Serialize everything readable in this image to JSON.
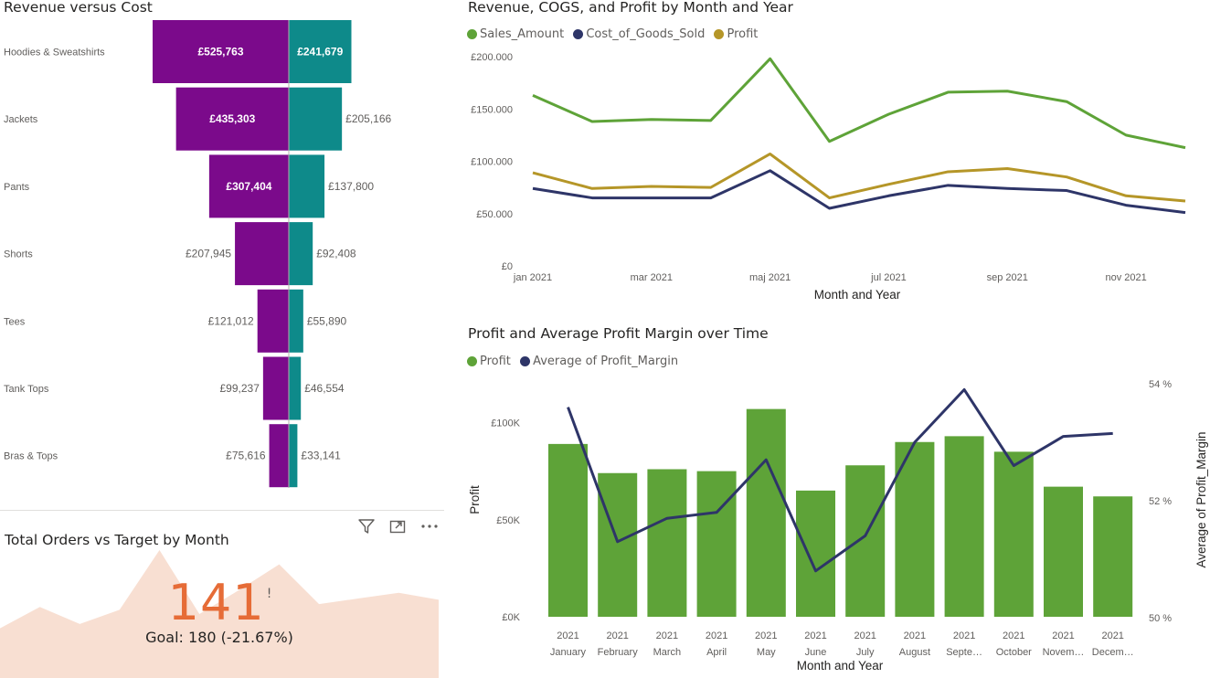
{
  "funnel": {
    "title": "Revenue versus Cost",
    "colors": {
      "revenue": "#7b0a8b",
      "cost": "#0e8a8a"
    },
    "chart_data": {
      "type": "bar",
      "categories": [
        "Hoodies & Sweatshirts",
        "Jackets",
        "Pants",
        "Shorts",
        "Tees",
        "Tank Tops",
        "Bras & Tops"
      ],
      "series": [
        {
          "values": [
            525763,
            435303,
            307404,
            207945,
            121012,
            99237,
            75616
          ]
        },
        {
          "values": [
            241679,
            205166,
            137800,
            92408,
            55890,
            46554,
            33141
          ]
        }
      ],
      "labels": {
        "revenue": [
          "£525,763",
          "£435,303",
          "£307,404",
          "£207,945",
          "£121,012",
          "£99,237",
          "£75,616"
        ],
        "cost": [
          "£241,679",
          "£205,166",
          "£137,800",
          "£92,408",
          "£55,890",
          "£46,554",
          "£33,141"
        ]
      }
    }
  },
  "line_chart": {
    "title": "Revenue, COGS, and Profit by Month and Year",
    "legend": [
      {
        "name": "Sales_Amount",
        "color": "#5ea338"
      },
      {
        "name": "Cost_of_Goods_Sold",
        "color": "#2e3568"
      },
      {
        "name": "Profit",
        "color": "#b59628"
      }
    ],
    "chart_data": {
      "type": "line",
      "x": [
        "jan 2021",
        "feb 2021",
        "mar 2021",
        "apr 2021",
        "maj 2021",
        "jun 2021",
        "jul 2021",
        "aug 2021",
        "sep 2021",
        "okt 2021",
        "nov 2021",
        "dec 2021"
      ],
      "x_tick_labels": [
        "jan 2021",
        "mar 2021",
        "maj 2021",
        "jul 2021",
        "sep 2021",
        "nov 2021"
      ],
      "y_tick_labels": [
        "£0",
        "£50.000",
        "£100.000",
        "£150.000",
        "£200.000"
      ],
      "ylim": [
        0,
        200000
      ],
      "xlabel": "Month and Year",
      "series": [
        {
          "name": "Sales_Amount",
          "values": [
            163000,
            138000,
            140000,
            139000,
            198000,
            119000,
            145000,
            166000,
            167000,
            157000,
            125000,
            113000
          ]
        },
        {
          "name": "Cost_of_Goods_Sold",
          "values": [
            74000,
            65000,
            65000,
            65000,
            91000,
            55000,
            67000,
            77000,
            74000,
            72000,
            58000,
            51000
          ]
        },
        {
          "name": "Profit",
          "values": [
            89000,
            74000,
            76000,
            75000,
            107000,
            65000,
            78000,
            90000,
            93000,
            85000,
            67000,
            62000
          ]
        }
      ]
    }
  },
  "combo_chart": {
    "title": "Profit and Average Profit Margin over Time",
    "legend": [
      {
        "name": "Profit",
        "color": "#5ea338"
      },
      {
        "name": "Average of Profit_Margin",
        "color": "#2e3568"
      }
    ],
    "chart_data": {
      "type": "bar",
      "categories": [
        "January",
        "February",
        "March",
        "April",
        "May",
        "June",
        "July",
        "August",
        "Septe…",
        "October",
        "Novem…",
        "Decem…"
      ],
      "category_year": "2021",
      "xlabel": "Month and Year",
      "ylabel": "Profit",
      "y2label": "Average of Profit_Margin",
      "ylim": [
        0,
        100000
      ],
      "y_tick_labels": [
        "£0K",
        "£50K",
        "£100K"
      ],
      "y2lim": [
        50,
        54
      ],
      "y2_tick_labels": [
        "50 %",
        "52 %",
        "54 %"
      ],
      "series": [
        {
          "name": "Profit",
          "values": [
            89000,
            74000,
            76000,
            75000,
            107000,
            65000,
            78000,
            90000,
            93000,
            85000,
            67000,
            62000
          ]
        },
        {
          "name": "Average of Profit_Margin",
          "values": [
            53.6,
            51.3,
            51.7,
            51.8,
            52.7,
            50.8,
            51.4,
            53.0,
            53.9,
            52.6,
            53.1,
            53.15
          ]
        }
      ]
    }
  },
  "kpi": {
    "title": "Total Orders vs Target by Month",
    "value": "141",
    "flag": "!",
    "goal": "Goal: 180 (-21.67%)",
    "area_color": "#f8dfd2",
    "trend_values": [
      35,
      50,
      38,
      48,
      90,
      45,
      62,
      80,
      52,
      56,
      60,
      55
    ]
  },
  "toolbar": {
    "icons": [
      "filter-icon",
      "focus-mode-icon",
      "more-options-icon"
    ]
  }
}
